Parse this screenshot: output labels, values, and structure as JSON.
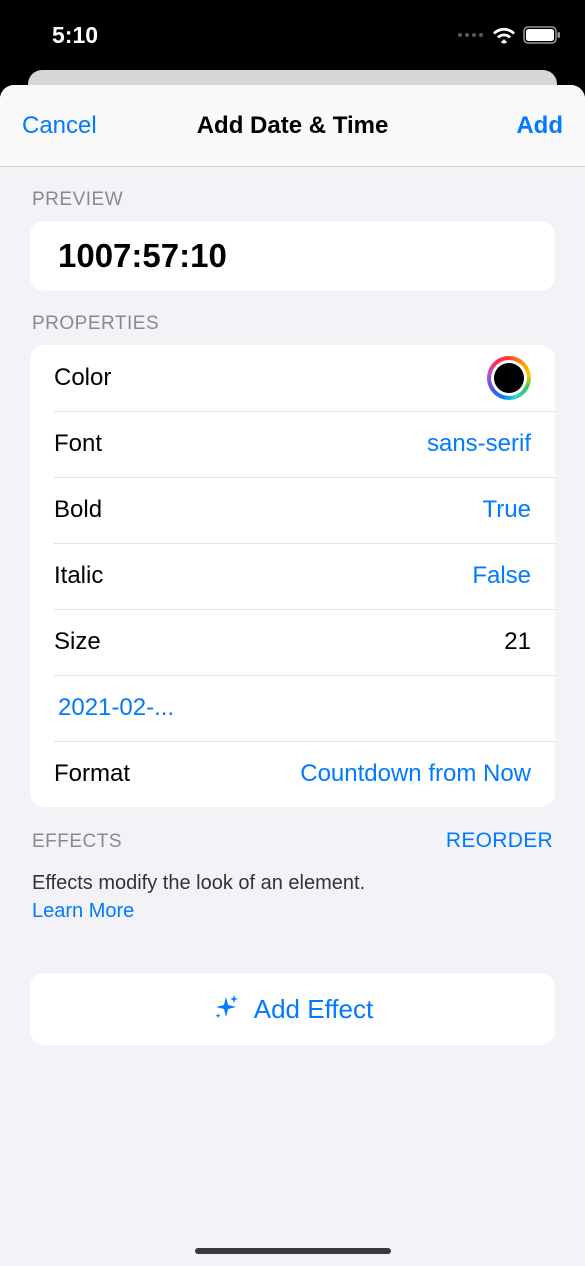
{
  "status": {
    "time": "5:10"
  },
  "nav": {
    "cancel": "Cancel",
    "title": "Add Date & Time",
    "add": "Add"
  },
  "preview": {
    "header": "PREVIEW",
    "value": "1007:57:10"
  },
  "properties": {
    "header": "PROPERTIES",
    "rows": {
      "color": {
        "label": "Color"
      },
      "font": {
        "label": "Font",
        "value": "sans-serif"
      },
      "bold": {
        "label": "Bold",
        "value": "True"
      },
      "italic": {
        "label": "Italic",
        "value": "False"
      },
      "size": {
        "label": "Size",
        "value": "21"
      },
      "date": {
        "value": "2021-02-..."
      },
      "format": {
        "label": "Format",
        "value": "Countdown from Now"
      }
    }
  },
  "effects": {
    "header": "EFFECTS",
    "reorder": "REORDER",
    "description": "Effects modify the look of an element.",
    "learn_more": "Learn More",
    "add_label": "Add Effect"
  }
}
